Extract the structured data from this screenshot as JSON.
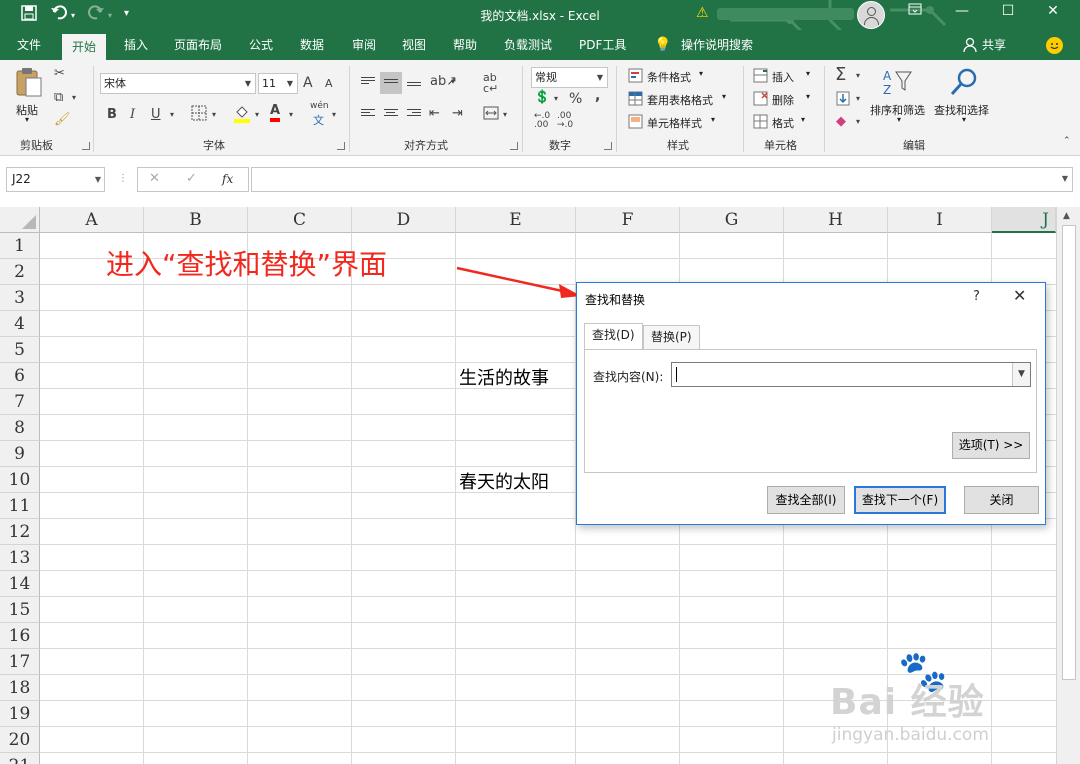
{
  "window": {
    "title": "我的文档.xlsx - Excel",
    "save_icon": "save-icon",
    "undo_icon": "undo-icon",
    "redo_icon": "redo-icon",
    "customize_icon": "customize-quick-access-icon",
    "ribbon_display_icon": "ribbon-display-options-icon",
    "minimize_icon": "minimize-icon",
    "restore_icon": "restore-icon",
    "close_icon": "close-icon",
    "accent_color": "#217346"
  },
  "tabs": [
    "文件",
    "开始",
    "插入",
    "页面布局",
    "公式",
    "数据",
    "审阅",
    "视图",
    "帮助",
    "负载测试",
    "PDF工具"
  ],
  "tell_me": "操作说明搜索",
  "share": "共享",
  "ribbon": {
    "clipboard": {
      "paste": "粘贴",
      "label": "剪贴板"
    },
    "font": {
      "name": "宋体",
      "size": "11",
      "label": "字体",
      "bold": "B",
      "italic": "I",
      "underline": "U",
      "grow": "A",
      "shrink": "A",
      "font_color_letter": "A",
      "phonetic": "wén"
    },
    "alignment": {
      "label": "对齐方式"
    },
    "number": {
      "format": "常规",
      "label": "数字",
      "percent": "%",
      "comma": ","
    },
    "styles": {
      "conditional": "条件格式",
      "table": "套用表格格式",
      "cell_styles": "单元格样式",
      "label": "样式"
    },
    "cells": {
      "insert": "插入",
      "delete": "删除",
      "format": "格式",
      "label": "单元格"
    },
    "editing": {
      "sort_filter": "排序和筛选",
      "find_select": "查找和选择",
      "label": "编辑"
    }
  },
  "formula_bar": {
    "name_box": "J22",
    "cancel": "✕",
    "enter": "✓",
    "fx": "fx",
    "value": ""
  },
  "columns": [
    "A",
    "B",
    "C",
    "D",
    "E",
    "F",
    "G",
    "H",
    "I",
    "J"
  ],
  "selected_column": "J",
  "rows": [
    "1",
    "2",
    "3",
    "4",
    "5",
    "6",
    "7",
    "8",
    "9",
    "10",
    "11",
    "12",
    "13",
    "14",
    "15",
    "16",
    "17",
    "18",
    "19",
    "20",
    "21"
  ],
  "cells": {
    "E6": "生活的故事",
    "E10": "春天的太阳"
  },
  "annotation": {
    "text": "进入“查找和替换”界面",
    "color": "#f0281e"
  },
  "dialog": {
    "title": "查找和替换",
    "help": "?",
    "close": "✕",
    "tab_find": "查找(D)",
    "tab_replace": "替换(P)",
    "find_label": "查找内容(N):",
    "find_value": "",
    "options": "选项(T) >>",
    "find_all": "查找全部(I)",
    "find_next": "查找下一个(F)",
    "close_button": "关闭"
  },
  "watermark": {
    "brand": "Bai 经验",
    "url": "jingyan.baidu.com"
  }
}
